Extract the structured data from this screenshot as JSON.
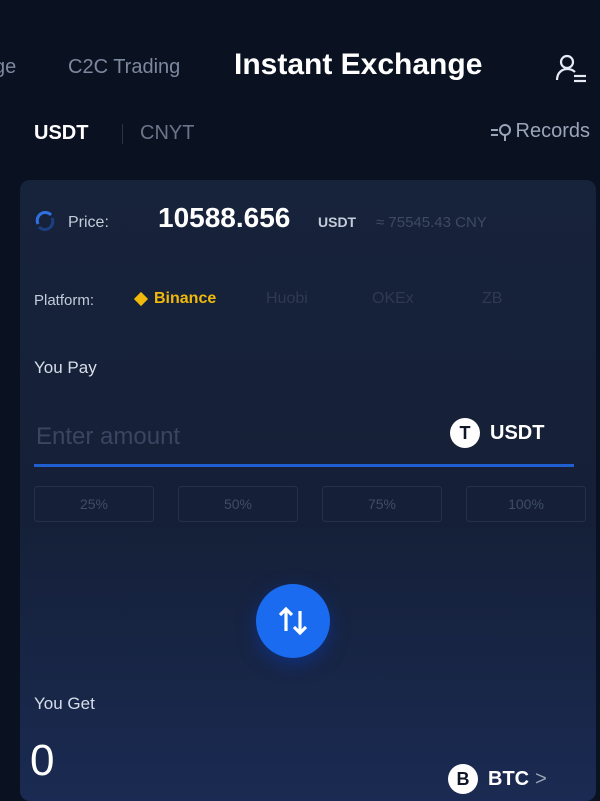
{
  "top_nav": {
    "exchange_partial": "ge",
    "c2c": "C2C Trading",
    "instant": "Instant Exchange"
  },
  "currency_tabs": {
    "usdt": "USDT",
    "cnyt": "CNYT",
    "records": "Records"
  },
  "price": {
    "label": "Price:",
    "value": "10588.656",
    "unit": "USDT",
    "cny": "≈ 75545.43 CNY"
  },
  "platform": {
    "label": "Platform:",
    "items": [
      "Binance",
      "Huobi",
      "OKEx",
      "ZB"
    ]
  },
  "pay": {
    "label": "You Pay",
    "placeholder": "Enter amount",
    "coin_symbol": "T",
    "coin": "USDT"
  },
  "percentages": [
    "25%",
    "50%",
    "75%",
    "100%"
  ],
  "get": {
    "label": "You Get",
    "value": "0",
    "coin_symbol": "B",
    "coin": "BTC",
    "chevron": ">"
  },
  "colors": {
    "accent": "#1a6bf0",
    "binance": "#f0b90b",
    "background": "#0a1120"
  }
}
